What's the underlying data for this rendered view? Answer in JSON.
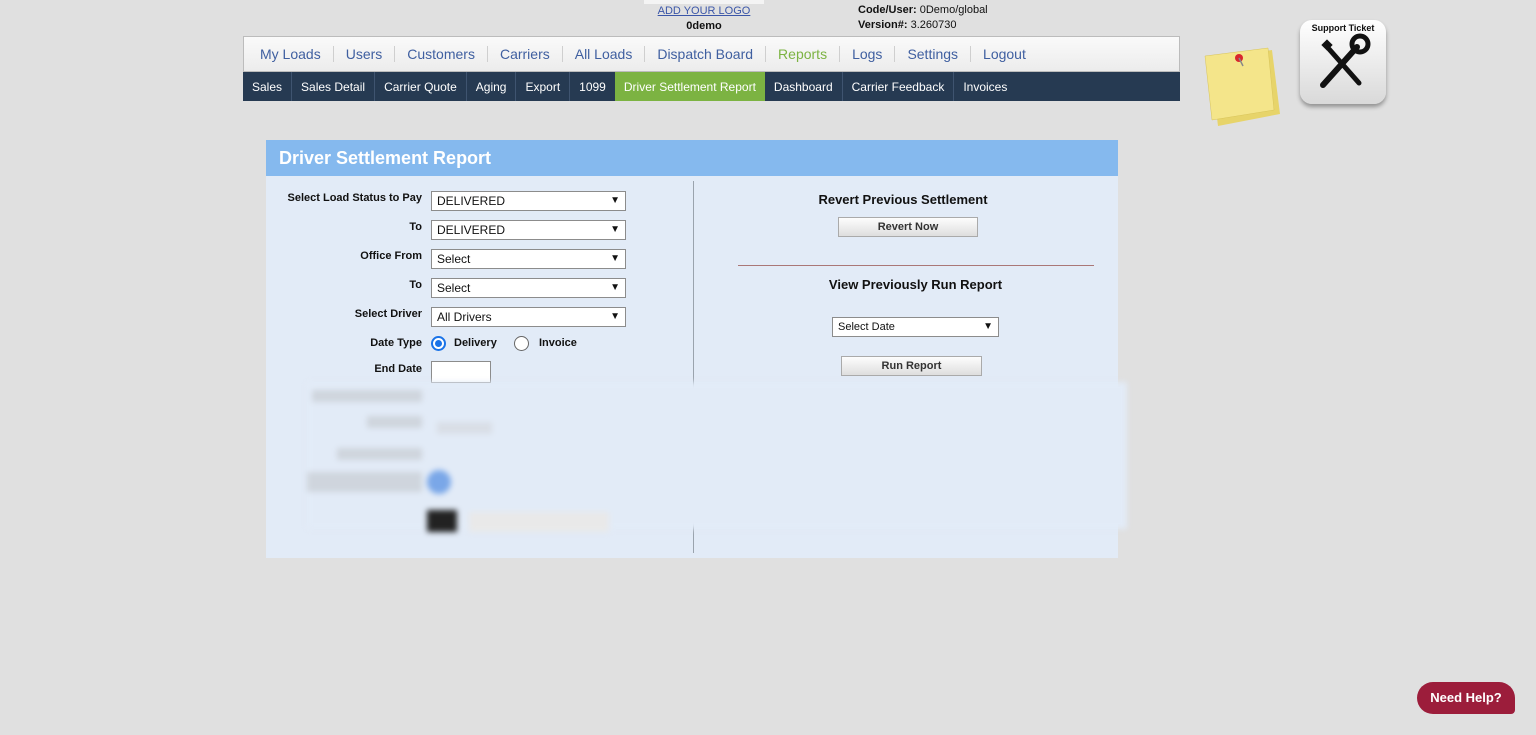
{
  "header": {
    "logo_link": "ADD YOUR LOGO",
    "company": "0demo",
    "code_label": "Code/User:",
    "code_value": "0Demo/global",
    "version_label": "Version#:",
    "version_value": "3.260730"
  },
  "main_nav": [
    "My Loads",
    "Users",
    "Customers",
    "Carriers",
    "All Loads",
    "Dispatch Board",
    "Reports",
    "Logs",
    "Settings",
    "Logout"
  ],
  "active_main": "Reports",
  "sub_nav": [
    "Sales",
    "Sales Detail",
    "Carrier Quote",
    "Aging",
    "Export",
    "1099",
    "Driver Settlement Report",
    "Dashboard",
    "Carrier Feedback",
    "Invoices"
  ],
  "active_sub": "Driver Settlement Report",
  "support_ticket": "Support Ticket",
  "panel": {
    "title": "Driver Settlement Report",
    "form": {
      "status_from_label": "Select Load Status to Pay",
      "status_from_value": "DELIVERED",
      "status_to_label": "To",
      "status_to_value": "DELIVERED",
      "office_from_label": "Office From",
      "office_from_value": "Select",
      "office_to_label": "To",
      "office_to_value": "Select",
      "driver_label": "Select Driver",
      "driver_value": "All Drivers",
      "date_type_label": "Date Type",
      "date_type_options": [
        "Delivery",
        "Invoice"
      ],
      "date_type_selected": "Delivery",
      "end_date_label": "End Date"
    },
    "right": {
      "revert_heading": "Revert Previous Settlement",
      "revert_button": "Revert Now",
      "view_heading": "View Previously Run Report",
      "select_date_value": "Select Date",
      "run_button": "Run Report"
    }
  },
  "need_help": "Need Help?",
  "colors": {
    "nav_active": "#7cb342",
    "subnav_bg": "#263a52",
    "panel_header": "#85b9ee",
    "need_help": "#9c1d3b"
  }
}
